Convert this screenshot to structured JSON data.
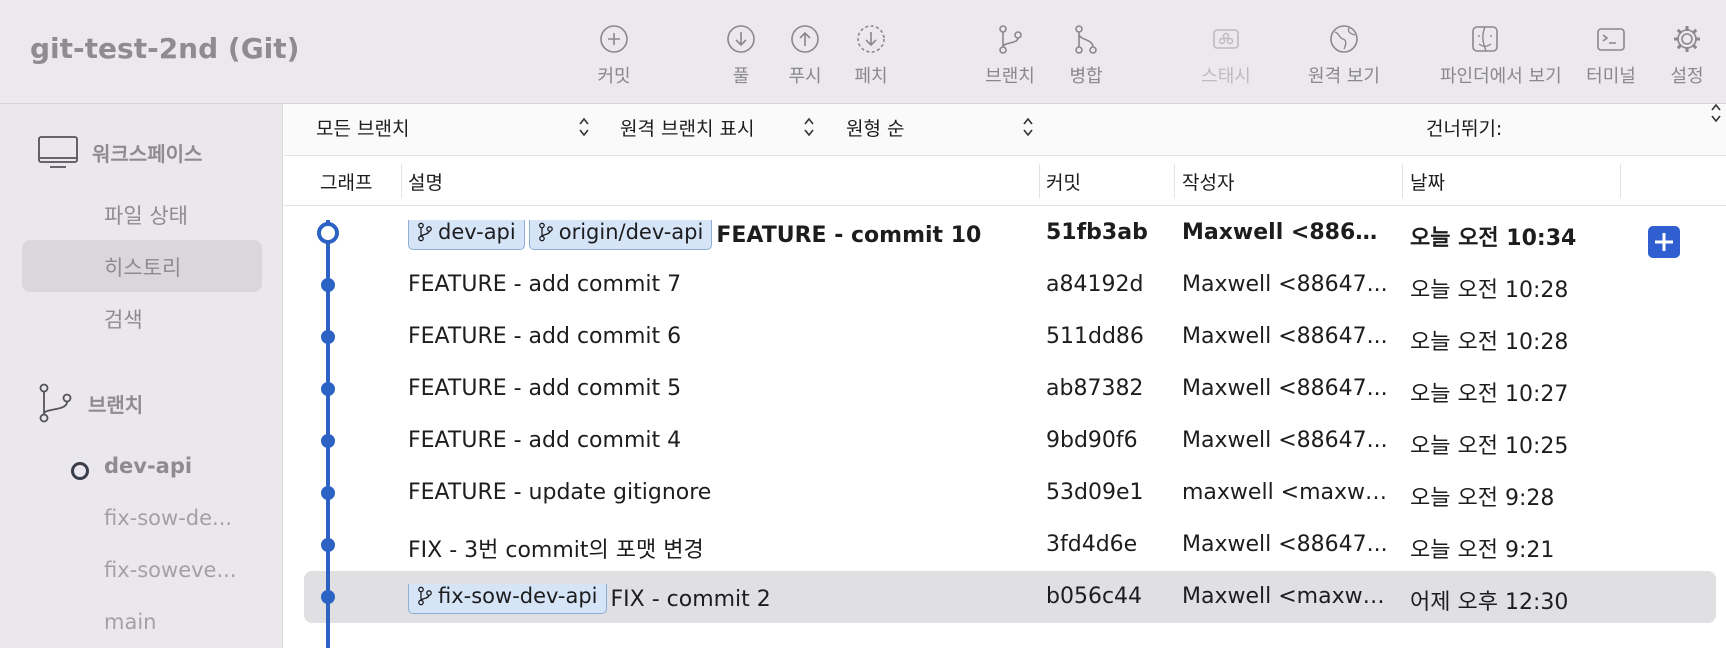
{
  "app": {
    "title": "git-test-2nd (Git)"
  },
  "toolbar": {
    "commit": "커밋",
    "pull": "풀",
    "push": "푸시",
    "fetch": "페치",
    "branch": "브랜치",
    "merge": "병합",
    "stash": "스태시",
    "remote": "원격 보기",
    "finder": "파인더에서 보기",
    "terminal": "터미널",
    "settings": "설정"
  },
  "sidebar": {
    "workspace": "워크스페이스",
    "file_status": "파일 상태",
    "history": "히스토리",
    "search": "검색",
    "branches_header": "브랜치",
    "branches": [
      "dev-api",
      "fix-sow-de...",
      "fix-soweve...",
      "main"
    ]
  },
  "filters": {
    "branches": "모든 브랜치",
    "remote": "원격 브랜치 표시",
    "order": "원형 순",
    "jump": "건너뛰기:"
  },
  "columns": {
    "graph": "그래프",
    "description": "설명",
    "commit": "커밋",
    "author": "작성자",
    "date": "날짜"
  },
  "commits": [
    {
      "tags": [
        "dev-api",
        "origin/dev-api"
      ],
      "description": "FEATURE - commit 10",
      "hash": "51fb3ab",
      "author": "Maxwell <8864...",
      "date": "오늘 오전 10:34",
      "bold": true
    },
    {
      "tags": [],
      "description": "FEATURE - add commit 7",
      "hash": "a84192d",
      "author": "Maxwell <88647...",
      "date": "오늘 오전 10:28"
    },
    {
      "tags": [],
      "description": "FEATURE - add commit 6",
      "hash": "511dd86",
      "author": "Maxwell <88647...",
      "date": "오늘 오전 10:28"
    },
    {
      "tags": [],
      "description": "FEATURE - add commit 5",
      "hash": "ab87382",
      "author": "Maxwell <88647...",
      "date": "오늘 오전 10:27"
    },
    {
      "tags": [],
      "description": "FEATURE - add commit 4",
      "hash": "9bd90f6",
      "author": "Maxwell <88647...",
      "date": "오늘 오전 10:25"
    },
    {
      "tags": [],
      "description": "FEATURE - update gitignore",
      "hash": "53d09e1",
      "author": "maxwell <maxwe...",
      "date": "오늘 오전 9:28"
    },
    {
      "tags": [],
      "description": "FIX - 3번 commit의 포맷 변경",
      "hash": "3fd4d6e",
      "author": "Maxwell <88647...",
      "date": "오늘 오전 9:21"
    },
    {
      "tags": [
        "fix-sow-dev-api"
      ],
      "description": "FIX - commit 2",
      "hash": "b056c44",
      "author": "Maxwell <maxwe...",
      "date": "어제 오후 12:30",
      "selected": true
    }
  ],
  "colors": {
    "graph": "#2c62c4",
    "tag_bg": "#d6e4f7",
    "tag_border": "#8eaed6",
    "add_button": "#2f5fd0"
  }
}
